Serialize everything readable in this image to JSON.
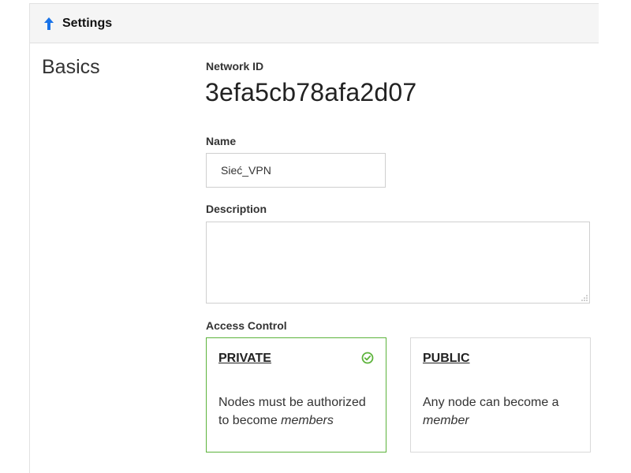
{
  "header": {
    "title": "Settings",
    "icon": "arrow-up-icon",
    "icon_color": "#1a73e8"
  },
  "section": {
    "title": "Basics"
  },
  "network_id": {
    "label": "Network ID",
    "value": "3efa5cb78afa2d07"
  },
  "name": {
    "label": "Name",
    "value": "Sieć_VPN"
  },
  "description": {
    "label": "Description",
    "value": ""
  },
  "access_control": {
    "label": "Access Control",
    "selected": "private",
    "accent": "#5cb33b",
    "options": [
      {
        "title": "PRIVATE",
        "desc_prefix": "Nodes must be authorized to become ",
        "desc_emph": "members",
        "icon": "check-circle-icon"
      },
      {
        "title": "PUBLIC",
        "desc_prefix": "Any node can become a ",
        "desc_emph": "member"
      }
    ]
  }
}
